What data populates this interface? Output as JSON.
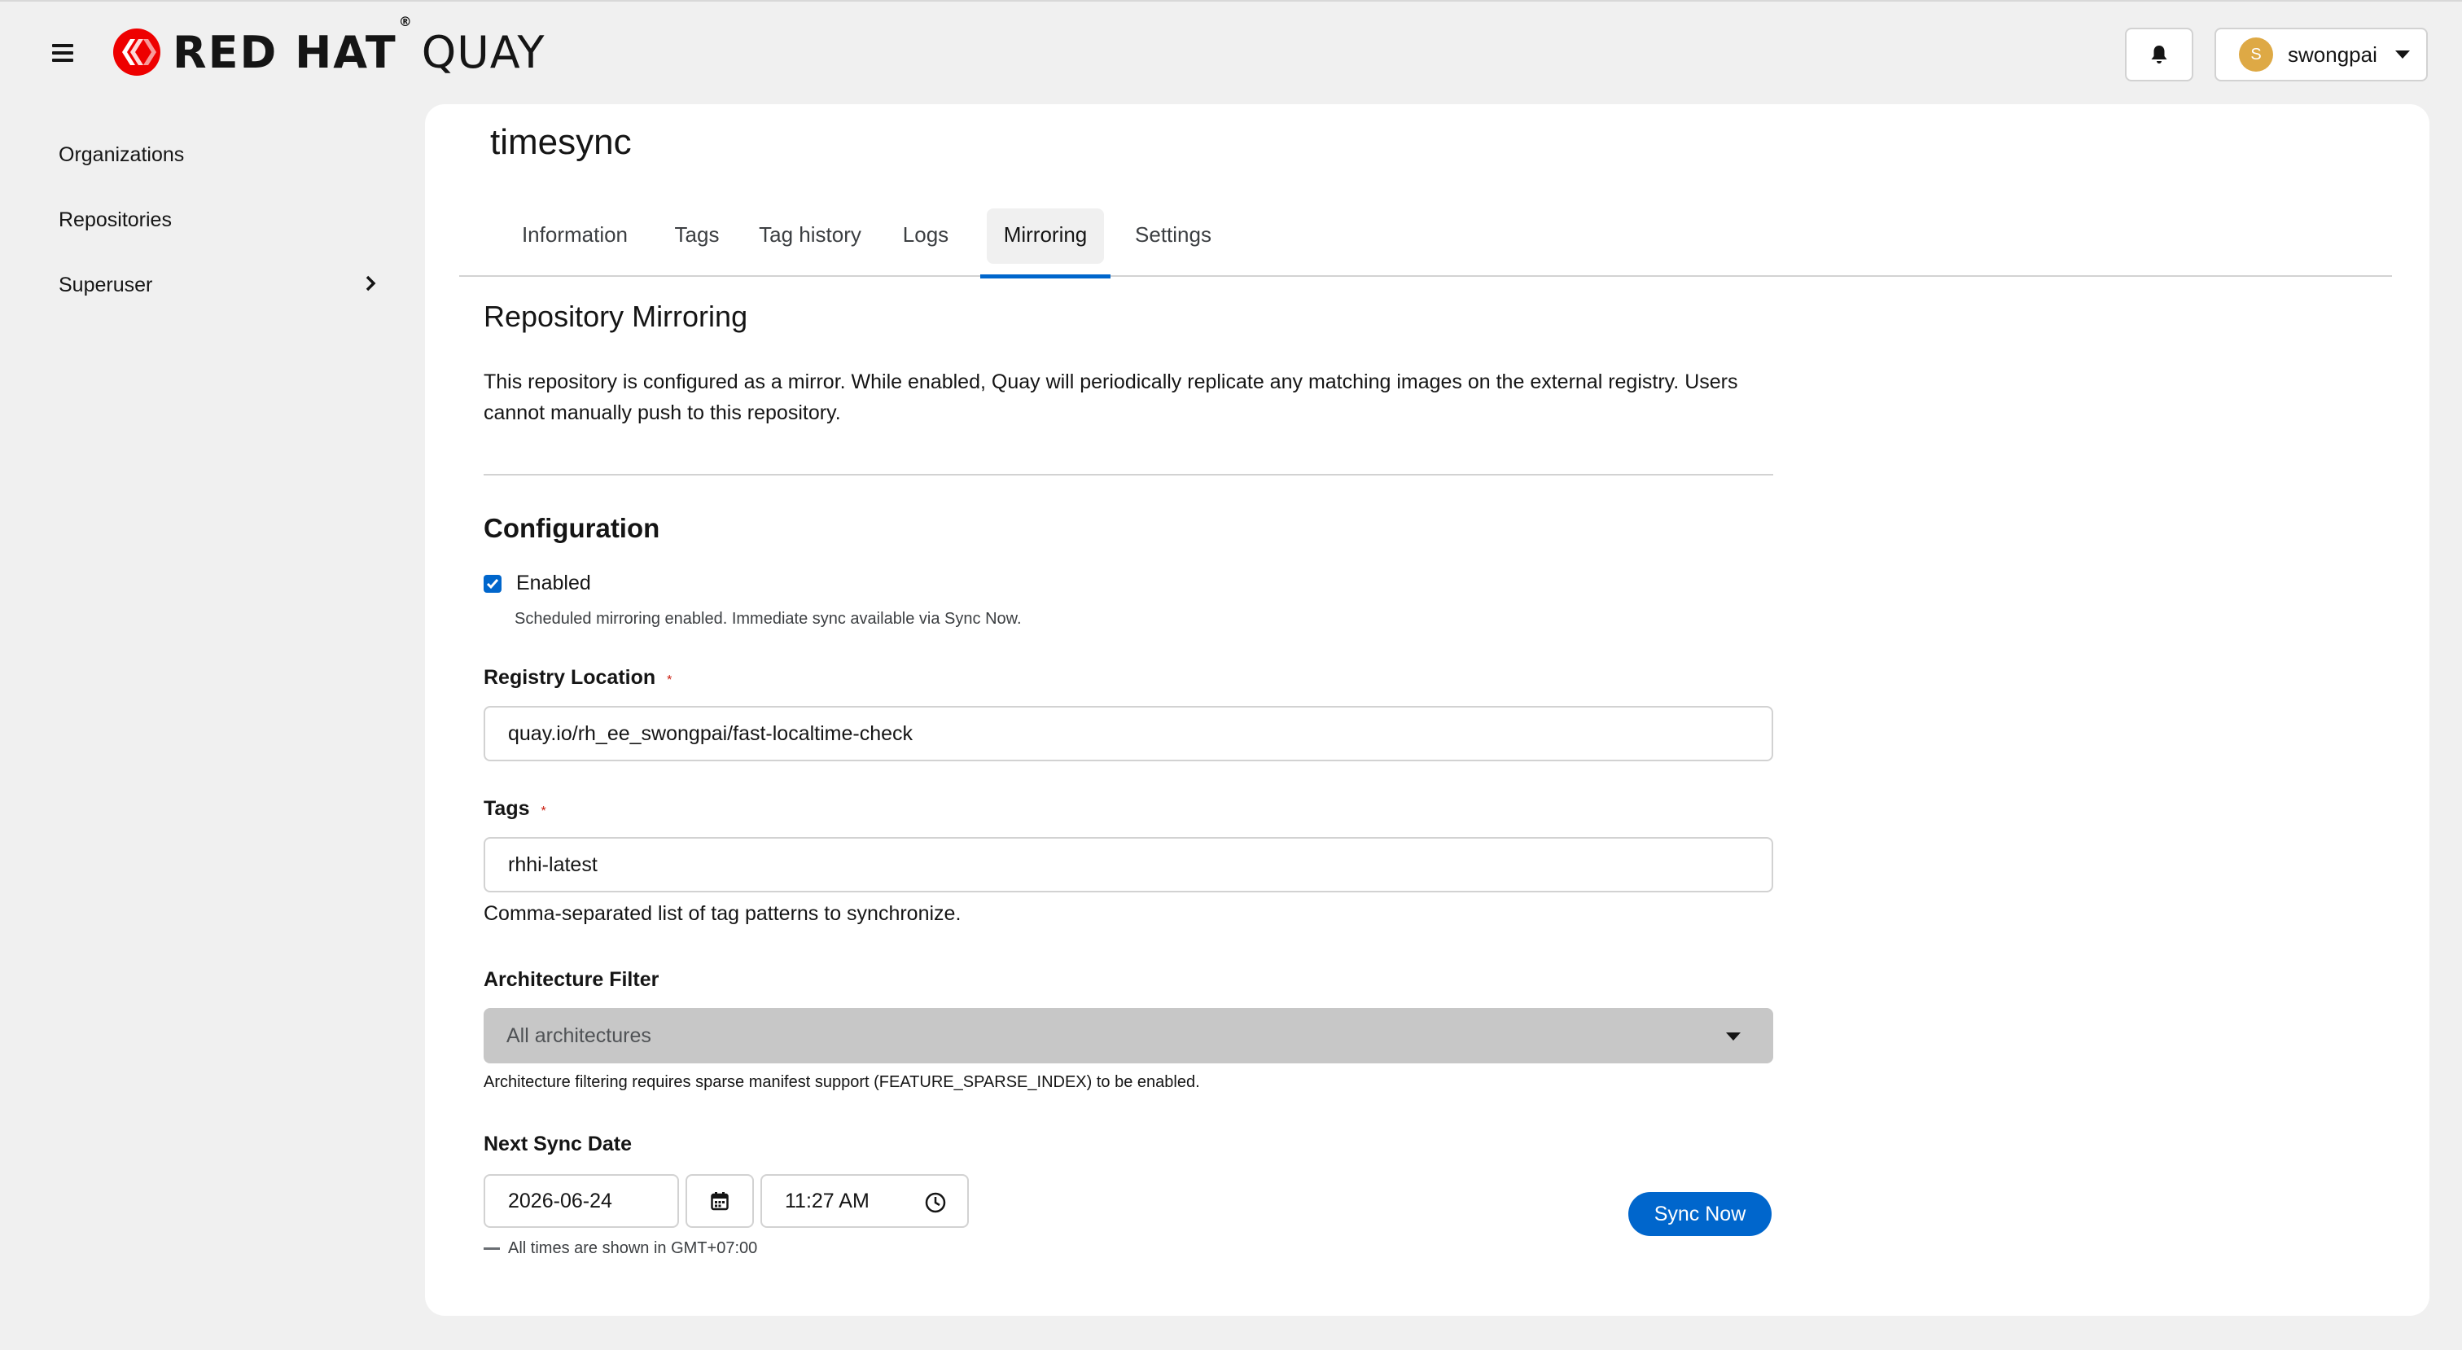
{
  "header": {
    "brand_bold": "RED HAT",
    "brand_reg": "®",
    "brand_light": "QUAY",
    "notifications_icon": "bell-icon",
    "user": {
      "initial": "S",
      "name": "swongpai"
    }
  },
  "sidebar": {
    "items": [
      {
        "label": "Organizations"
      },
      {
        "label": "Repositories"
      },
      {
        "label": "Superuser"
      }
    ]
  },
  "repo": {
    "name": "timesync"
  },
  "tabs": [
    {
      "label": "Information"
    },
    {
      "label": "Tags"
    },
    {
      "label": "Tag history"
    },
    {
      "label": "Logs"
    },
    {
      "label": "Mirroring",
      "active": true
    },
    {
      "label": "Settings"
    }
  ],
  "mirroring": {
    "title": "Repository Mirroring",
    "description": "This repository is configured as a mirror. While enabled, Quay will periodically replicate any matching images on the external registry. Users cannot manually push to this repository.",
    "config_title": "Configuration",
    "enabled": {
      "label": "Enabled",
      "checked": true,
      "help": "Scheduled mirroring enabled. Immediate sync available via Sync Now."
    },
    "registry_location": {
      "label": "Registry Location",
      "required_mark": "*",
      "value": "quay.io/rh_ee_swongpai/fast-localtime-check"
    },
    "tags": {
      "label": "Tags",
      "required_mark": "*",
      "value": "rhhi-latest",
      "help": "Comma-separated list of tag patterns to synchronize."
    },
    "architecture_filter": {
      "label": "Architecture Filter",
      "selected": "All architectures",
      "help": "Architecture filtering requires sparse manifest support (FEATURE_SPARSE_INDEX) to be enabled."
    },
    "next_sync": {
      "label": "Next Sync Date",
      "date": "2026-06-24",
      "time": "11:27 AM",
      "timezone_note": "All times are shown in GMT+07:00",
      "sync_now_label": "Sync Now"
    }
  },
  "colors": {
    "accent": "#0066cc",
    "required": "#c9190b",
    "logo_red": "#ee0000",
    "avatar": "#dea945"
  }
}
